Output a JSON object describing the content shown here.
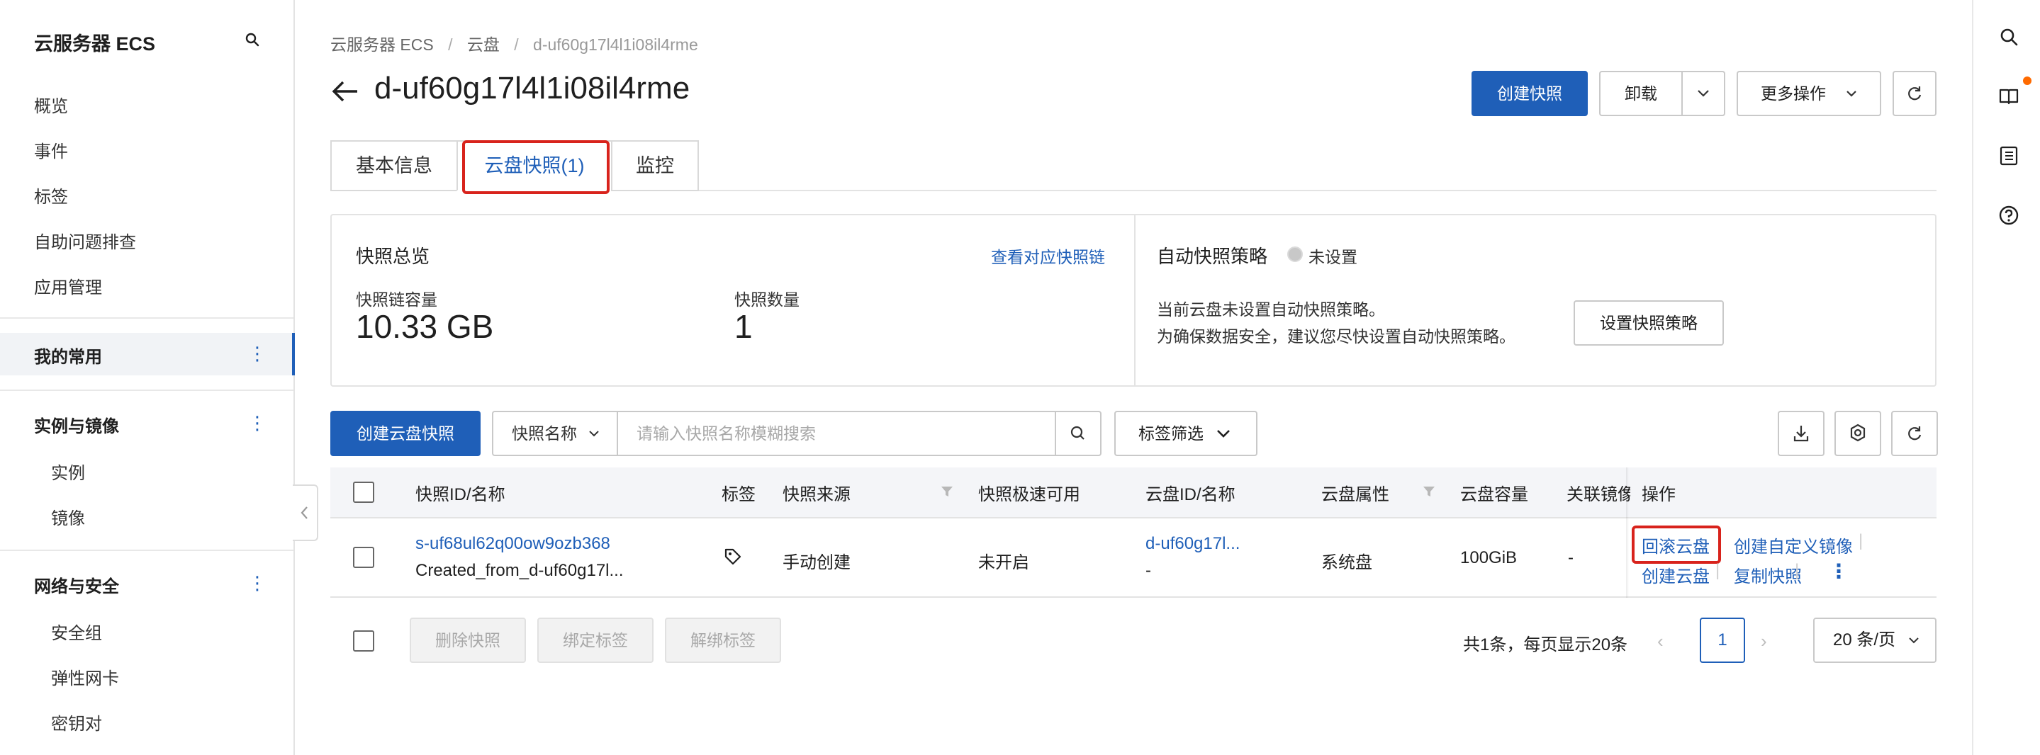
{
  "sidebar": {
    "title": "云服务器 ECS",
    "items": [
      "概览",
      "事件",
      "标签",
      "自助问题排查",
      "应用管理"
    ],
    "favorites": "我的常用",
    "groups": [
      {
        "label": "实例与镜像",
        "children": [
          "实例",
          "镜像"
        ]
      },
      {
        "label": "网络与安全",
        "children": [
          "安全组",
          "弹性网卡",
          "密钥对"
        ]
      }
    ]
  },
  "breadcrumb": [
    "云服务器 ECS",
    "/",
    "云盘",
    "/",
    "d-uf60g17l4l1i08il4rme"
  ],
  "title": "d-uf60g17l4l1i08il4rme",
  "header_buttons": {
    "create_snapshot": "创建快照",
    "unmount": "卸载",
    "more": "更多操作"
  },
  "tabs": [
    "基本信息",
    "云盘快照(1)",
    "监控"
  ],
  "overview": {
    "heading": "快照总览",
    "view_chain_link": "查看对应快照链",
    "capacity_label": "快照链容量",
    "capacity_value": "10.33 GB",
    "count_label": "快照数量",
    "count_value": "1",
    "policy_heading": "自动快照策略",
    "policy_status": "未设置",
    "policy_line1": "当前云盘未设置自动快照策略。",
    "policy_line2": "为确保数据安全，建议您尽快设置自动快照策略。",
    "policy_button": "设置快照策略"
  },
  "toolbar": {
    "create_button": "创建云盘快照",
    "filter_select": "快照名称",
    "search_placeholder": "请输入快照名称模糊搜索",
    "tag_filter": "标签筛选"
  },
  "table": {
    "columns": [
      "快照ID/名称",
      "标签",
      "快照来源",
      "快照极速可用",
      "云盘ID/名称",
      "云盘属性",
      "云盘容量",
      "关联镜像",
      "操作"
    ],
    "rows": [
      {
        "id": "s-uf68ul62q00ow9ozb368",
        "name": "Created_from_d-uf60g17l...",
        "source": "手动创建",
        "instant_access": "未开启",
        "disk_id": "d-uf60g17l...",
        "disk_name": "-",
        "disk_attr": "系统盘",
        "capacity": "100GiB",
        "image": "-",
        "actions": [
          "回滚云盘",
          "创建自定义镜像",
          "创建云盘",
          "复制快照"
        ]
      }
    ]
  },
  "footer": {
    "delete": "删除快照",
    "bind_tag": "绑定标签",
    "unbind_tag": "解绑标签",
    "page_info": "共1条，每页显示20条",
    "current_page": "1",
    "page_size": "20 条/页"
  },
  "colors": {
    "primary": "#1f5fb8",
    "highlight": "#d8231c",
    "notify": "#ff6a00"
  }
}
